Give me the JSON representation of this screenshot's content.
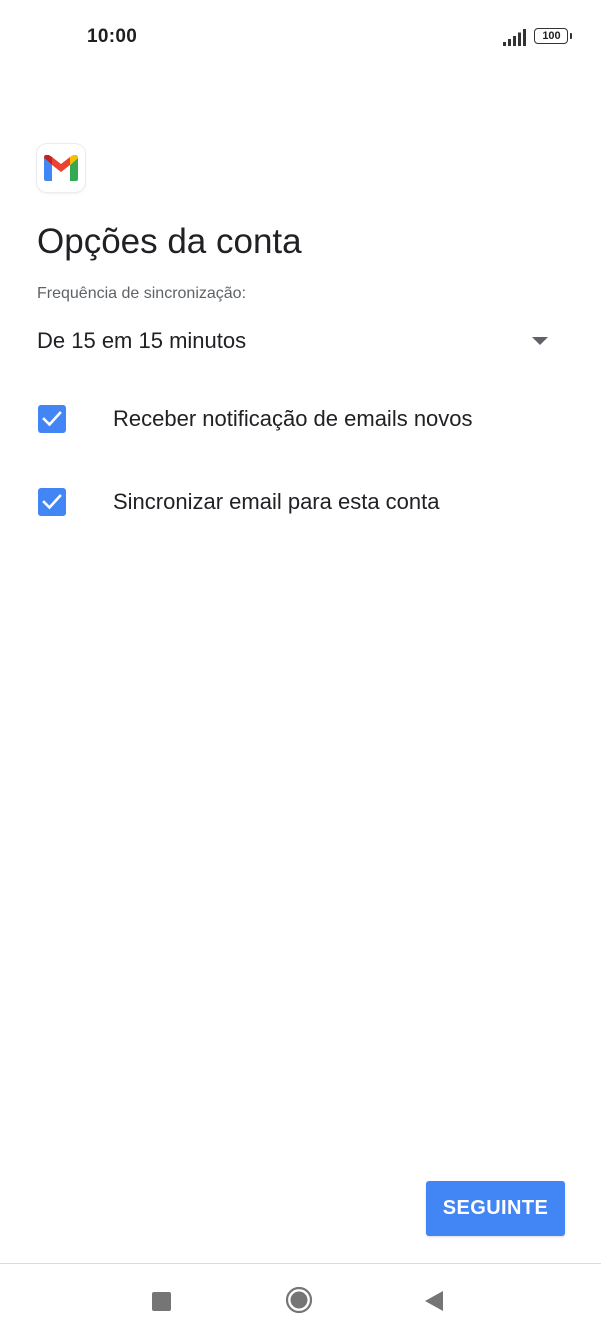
{
  "status_bar": {
    "time": "10:00",
    "battery": "100",
    "icons": [
      "signal-icon",
      "battery-icon"
    ]
  },
  "app": {
    "logo_icon": "gmail-logo-icon",
    "title": "Opções da conta"
  },
  "sync": {
    "label": "Frequência de sincronização:",
    "selected": "De 15 em 15 minutos"
  },
  "options": [
    {
      "label": "Receber notificação de emails novos",
      "checked": true
    },
    {
      "label": "Sincronizar email para esta conta",
      "checked": true
    }
  ],
  "actions": {
    "next_label": "SEGUINTE"
  },
  "nav_bar": {
    "icons": [
      "recent-apps-icon",
      "home-icon",
      "back-icon"
    ]
  },
  "colors": {
    "accent": "#4285f4",
    "text_primary": "#202124",
    "text_secondary": "#5f6368"
  }
}
